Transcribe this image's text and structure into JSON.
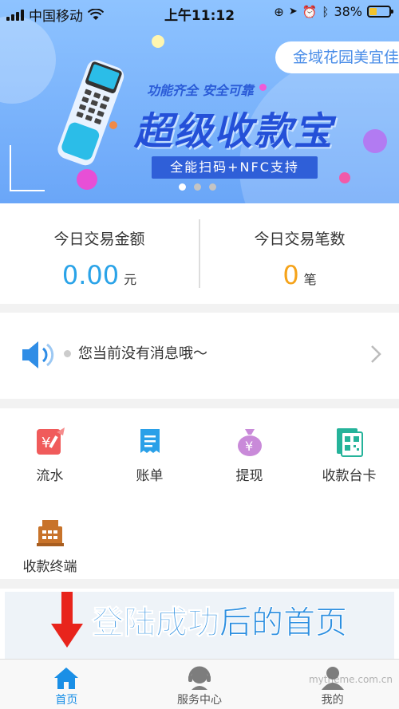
{
  "status_bar": {
    "carrier": "中国移动",
    "time": "上午11:12",
    "battery_percent": "38%",
    "battery_level": 0.38
  },
  "banner": {
    "store_name": "金域花园美宜佳",
    "tagline": "功能齐全 安全可靠",
    "title": "超级收款宝",
    "subtitle": "全能扫码+NFC支持",
    "page_count": 3,
    "active_page": 0
  },
  "stats": {
    "amount_label": "今日交易金额",
    "amount_value": "0.00",
    "amount_unit": "元",
    "count_label": "今日交易笔数",
    "count_value": "0",
    "count_unit": "笔",
    "amount_color": "#2aa3e8",
    "count_color": "#f5a31a"
  },
  "notice": {
    "text": "您当前没有消息哦～"
  },
  "grid": {
    "items": [
      {
        "label": "流水",
        "icon": "ledger-icon",
        "color": "#f05b5b"
      },
      {
        "label": "账单",
        "icon": "bill-icon",
        "color": "#2aa0e8"
      },
      {
        "label": "提现",
        "icon": "money-bag-icon",
        "color": "#c98ad9"
      },
      {
        "label": "收款台卡",
        "icon": "qr-card-icon",
        "color": "#25b39a"
      },
      {
        "label": "收款终端",
        "icon": "cash-register-icon",
        "color": "#c8732a"
      }
    ]
  },
  "promo": {
    "title_bold": "登陆成功",
    "title_rest": "后的首页"
  },
  "tabbar": {
    "tabs": [
      {
        "label": "首页",
        "icon": "home-icon",
        "active": true
      },
      {
        "label": "服务中心",
        "icon": "service-agent-icon",
        "active": false
      },
      {
        "label": "我的",
        "icon": "profile-icon",
        "active": false
      }
    ]
  },
  "watermark": "mytheme.com.cn"
}
